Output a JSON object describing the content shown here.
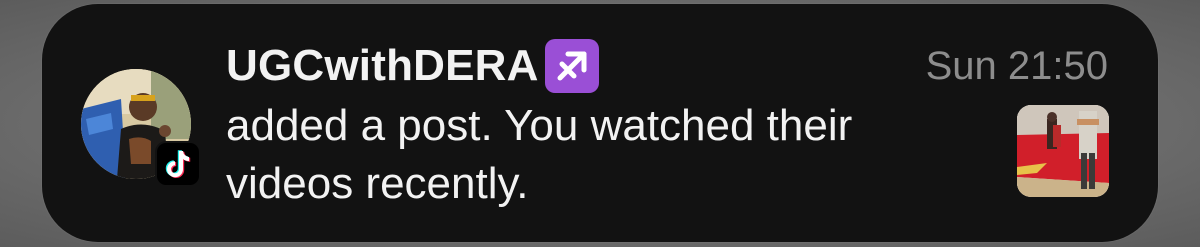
{
  "notification": {
    "app_name": "TikTok",
    "app_icon": "tiktok-icon",
    "sender": "UGCwithDERA",
    "sender_emoji": "sagittarius-emoji",
    "time": "Sun 21:50",
    "message": "added a post. You watched their videos recently.",
    "colors": {
      "card_background": "#121212",
      "primary_text": "#f2f2f2",
      "secondary_text": "#8d8d8d",
      "emoji_background": "#9a4fd6"
    }
  }
}
